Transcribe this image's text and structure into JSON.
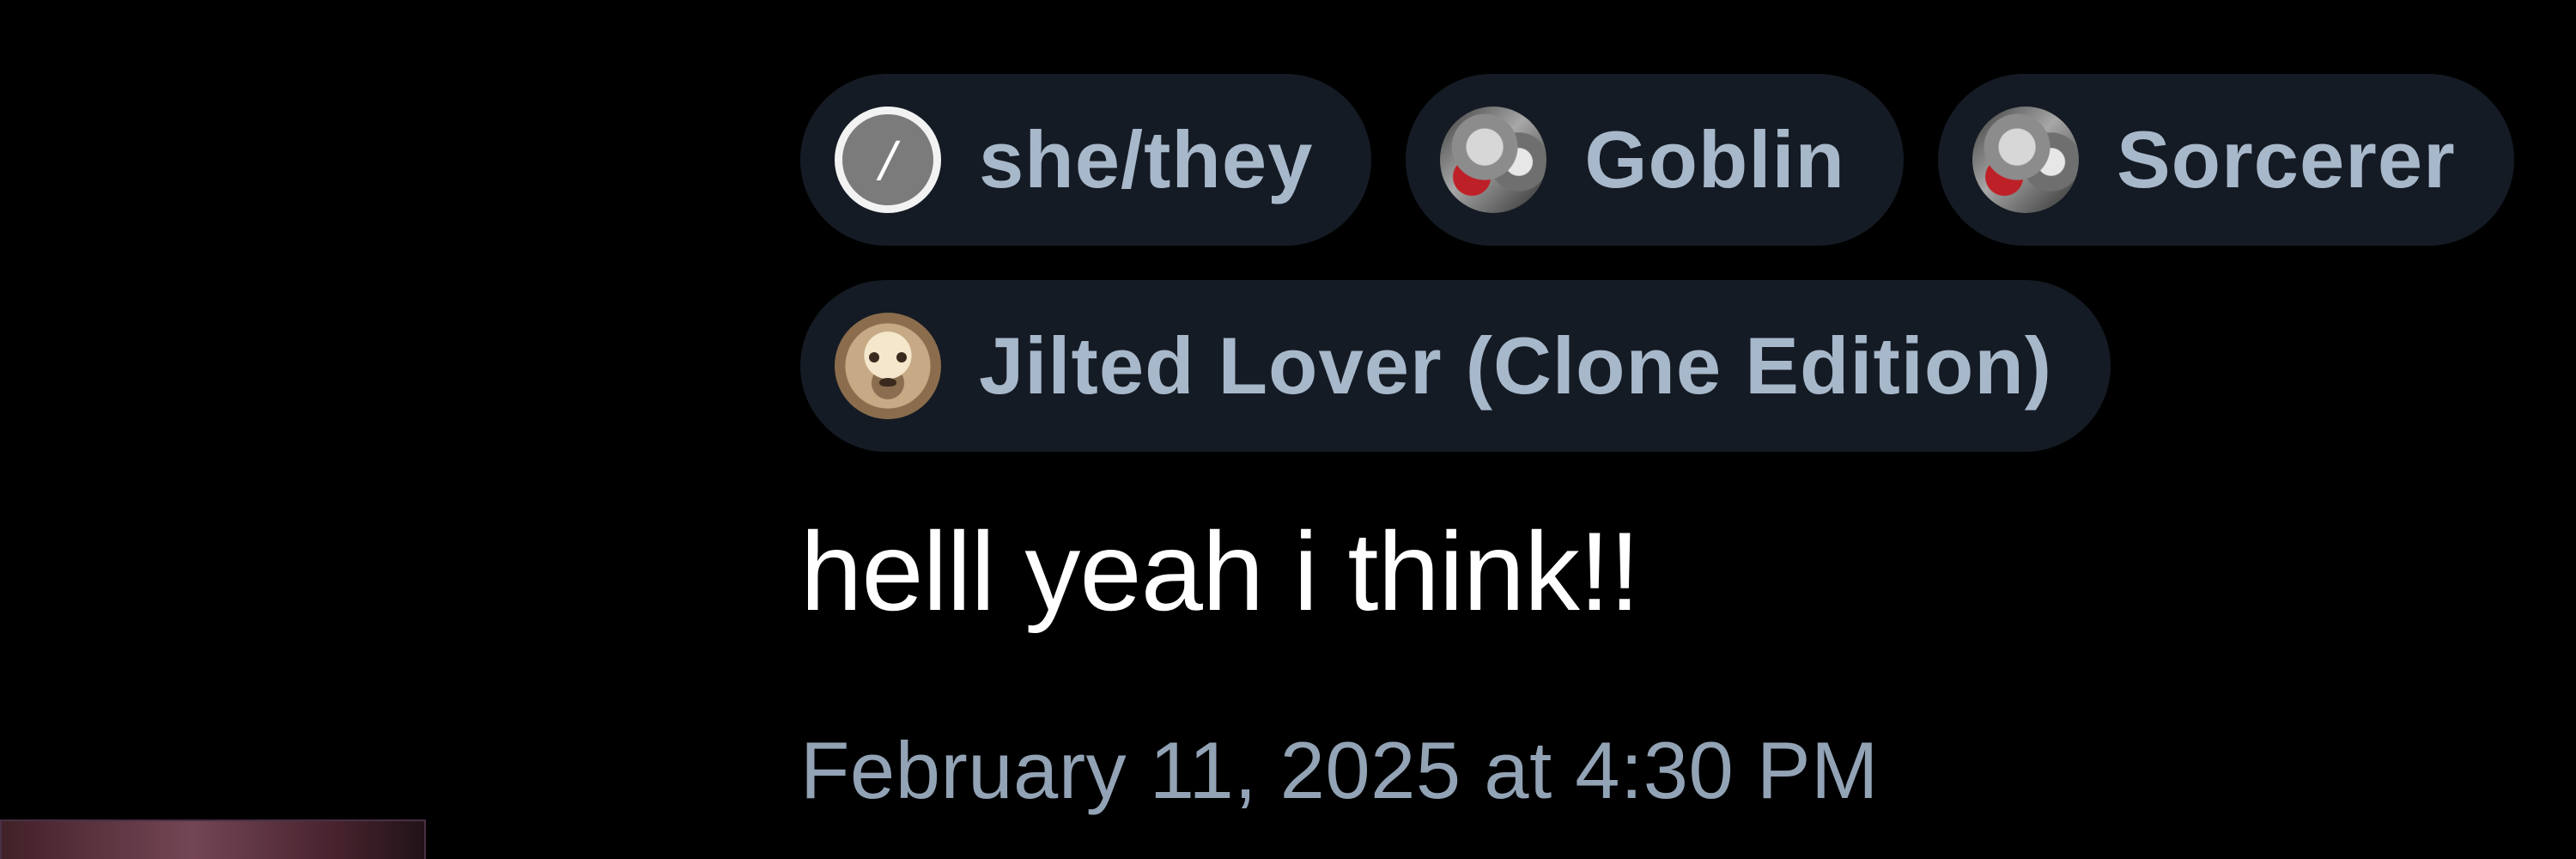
{
  "tags": [
    {
      "row": 1,
      "label": "she/they",
      "avatar_icon": "slash-icon",
      "avatar_text": "/"
    },
    {
      "row": 1,
      "label": "Goblin",
      "avatar_icon": "goblin-avatar-icon"
    },
    {
      "row": 1,
      "label": "Sorcerer",
      "avatar_icon": "sorcerer-avatar-icon"
    },
    {
      "row": 2,
      "label": "Jilted Lover (Clone Edition)",
      "avatar_icon": "mask-avatar-icon"
    }
  ],
  "message": {
    "text": "helll yeah i think!!"
  },
  "meta": {
    "timestamp": "February 11, 2025 at 4:30 PM"
  },
  "colors": {
    "background": "#000000",
    "tag_background": "#151b24",
    "tag_text": "#a8b8cb",
    "message_text": "#ffffff",
    "timestamp_text": "#93a3b6",
    "slash_avatar": "#7b7b7b",
    "accent_red": "#bd2026"
  }
}
